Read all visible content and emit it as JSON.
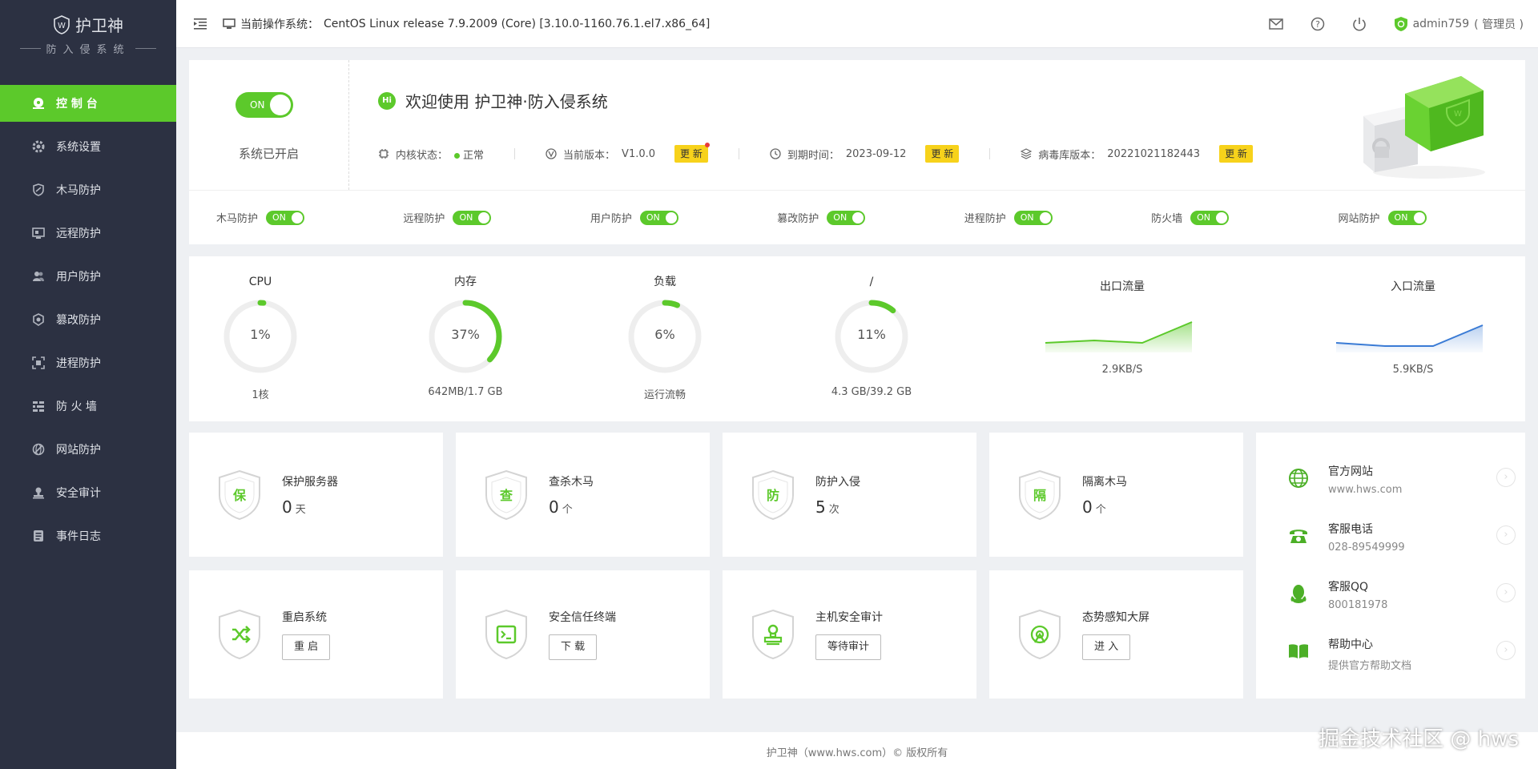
{
  "app": {
    "name": "护卫神",
    "subtitle": "防入侵系统"
  },
  "sidebar": {
    "items": [
      {
        "label": "控 制 台",
        "icon": "dashboard-icon"
      },
      {
        "label": "系统设置",
        "icon": "gear-icon"
      },
      {
        "label": "木马防护",
        "icon": "trojan-shield-icon"
      },
      {
        "label": "远程防护",
        "icon": "remote-icon"
      },
      {
        "label": "用户防护",
        "icon": "users-icon"
      },
      {
        "label": "篡改防护",
        "icon": "tamper-icon"
      },
      {
        "label": "进程防护",
        "icon": "process-icon"
      },
      {
        "label": "防 火 墙",
        "icon": "firewall-icon"
      },
      {
        "label": "网站防护",
        "icon": "website-icon"
      },
      {
        "label": "安全审计",
        "icon": "audit-icon"
      },
      {
        "label": "事件日志",
        "icon": "log-icon"
      }
    ]
  },
  "topbar": {
    "os_label": "当前操作系统：",
    "os_value": "CentOS Linux release 7.9.2009 (Core) [3.10.0-1160.76.1.el7.x86_64]",
    "username": "admin759",
    "role": "( 管理员 )"
  },
  "system": {
    "toggle": "ON",
    "status_label": "系统已开启",
    "welcome": "欢迎使用 护卫神·防入侵系统",
    "hi_badge": "Hi",
    "kernel_label": "内核状态：",
    "kernel_value": "正常",
    "version_label": "当前版本：",
    "version_value": "V1.0.0",
    "expire_label": "到期时间：",
    "expire_value": "2023-09-12",
    "virus_label": "病毒库版本：",
    "virus_value": "20221021182443",
    "update_label": "更 新"
  },
  "protections": [
    {
      "label": "木马防护",
      "state": "ON"
    },
    {
      "label": "远程防护",
      "state": "ON"
    },
    {
      "label": "用户防护",
      "state": "ON"
    },
    {
      "label": "篡改防护",
      "state": "ON"
    },
    {
      "label": "进程防护",
      "state": "ON"
    },
    {
      "label": "防火墙",
      "state": "ON"
    },
    {
      "label": "网站防护",
      "state": "ON"
    }
  ],
  "gauges": [
    {
      "title": "CPU",
      "value": "1%",
      "percent": 1,
      "detail": "1核"
    },
    {
      "title": "内存",
      "value": "37%",
      "percent": 37,
      "detail": "642MB/1.7 GB"
    },
    {
      "title": "负载",
      "value": "6%",
      "percent": 6,
      "detail": "运行流畅"
    },
    {
      "title": "/",
      "value": "11%",
      "percent": 11,
      "detail": "4.3 GB/39.2 GB"
    }
  ],
  "traffic": {
    "out": {
      "title": "出口流量",
      "value": "2.9KB/S",
      "color": "#5cc92b"
    },
    "in": {
      "title": "入口流量",
      "value": "5.9KB/S",
      "color": "#3a7bd5"
    }
  },
  "stats": [
    {
      "label": "保护服务器",
      "value": "0",
      "unit": "天",
      "badge": "保"
    },
    {
      "label": "查杀木马",
      "value": "0",
      "unit": "个",
      "badge": "查"
    },
    {
      "label": "防护入侵",
      "value": "5",
      "unit": "次",
      "badge": "防"
    },
    {
      "label": "隔离木马",
      "value": "0",
      "unit": "个",
      "badge": "隔"
    }
  ],
  "actions": [
    {
      "label": "重启系统",
      "button": "重 启",
      "icon": "shuffle-icon"
    },
    {
      "label": "安全信任终端",
      "button": "下 载",
      "icon": "terminal-icon"
    },
    {
      "label": "主机安全审计",
      "button": "等待审计",
      "icon": "stamp-icon"
    },
    {
      "label": "态势感知大屏",
      "button": "进 入",
      "icon": "radar-icon"
    }
  ],
  "contacts": [
    {
      "title": "官方网站",
      "sub": "www.hws.com",
      "icon": "globe-icon"
    },
    {
      "title": "客服电话",
      "sub": "028-89549999",
      "icon": "phone-icon"
    },
    {
      "title": "客服QQ",
      "sub": "800181978",
      "icon": "qq-icon"
    },
    {
      "title": "帮助中心",
      "sub": "提供官方帮助文档",
      "icon": "book-icon"
    }
  ],
  "footer": "护卫神（www.hws.com）© 版权所有",
  "watermark": "掘金技术社区 @ hws",
  "colors": {
    "accent": "#5cc92b",
    "sidebar": "#2c3142",
    "badge": "#f7d21b"
  }
}
